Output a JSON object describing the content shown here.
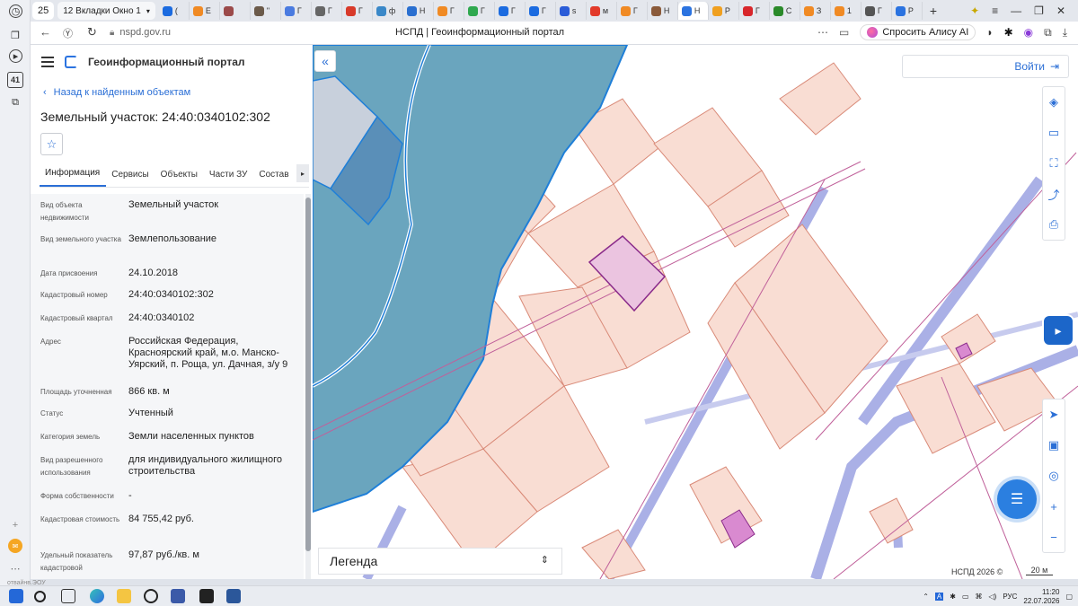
{
  "browser": {
    "tab_count_badge": "25",
    "tab_group_label": "12 Вкладки Окно 1",
    "tabs": [
      {
        "label": "(",
        "color": "#1b6be0"
      },
      {
        "label": "E",
        "color": "#f08a24"
      },
      {
        "label": "",
        "color": "#9b4a4a"
      },
      {
        "label": "\"",
        "color": "#6b5a4a"
      },
      {
        "label": "Г",
        "color": "#4a7be0"
      },
      {
        "label": "Г",
        "color": "#666666"
      },
      {
        "label": "Г",
        "color": "#d83a2a"
      },
      {
        "label": "ф",
        "color": "#3a88c8"
      },
      {
        "label": "Н",
        "color": "#2a6fd0"
      },
      {
        "label": "Г",
        "color": "#f08a24"
      },
      {
        "label": "Г",
        "color": "#2fa84f"
      },
      {
        "label": "Г",
        "color": "#1b6be0"
      },
      {
        "label": "Г",
        "color": "#1b6be0"
      },
      {
        "label": "s",
        "color": "#2a5cd8"
      },
      {
        "label": "м",
        "color": "#e23a2a"
      },
      {
        "label": "Г",
        "color": "#f08a24"
      },
      {
        "label": "Н",
        "color": "#8a5a3a"
      },
      {
        "label": "Н",
        "color": "#2b73e0",
        "active": true
      },
      {
        "label": "Р",
        "color": "#f0a020"
      },
      {
        "label": "Г",
        "color": "#d8262b"
      },
      {
        "label": "С",
        "color": "#2a8a2a"
      },
      {
        "label": "З",
        "color": "#f08a24"
      },
      {
        "label": "1",
        "color": "#f08a24"
      },
      {
        "label": "Г",
        "color": "#555555"
      },
      {
        "label": "Р",
        "color": "#2b73e0"
      }
    ],
    "new_tab": "+",
    "url": "nspd.gov.ru",
    "page_title": "НСПД | Геоинформационный портал",
    "alisa_label": "Спросить Алису AI",
    "rail_badge": "41"
  },
  "panel": {
    "app_title": "Геоинформационный портал",
    "back_label": "Назад к найденным объектам",
    "object_title": "Земельный участок: 24:40:0340102:302",
    "tabs": [
      "Информация",
      "Сервисы",
      "Объекты",
      "Части ЗУ",
      "Состав"
    ],
    "properties": [
      {
        "label": "Вид объекта недвижимости",
        "value": "Земельный участок"
      },
      {
        "label": "Вид земельного участка",
        "value": "Землепользование"
      },
      {
        "label": "Дата присвоения",
        "value": "24.10.2018"
      },
      {
        "label": "Кадастровый номер",
        "value": "24:40:0340102:302"
      },
      {
        "label": "Кадастровый квартал",
        "value": "24:40:0340102"
      },
      {
        "label": "Адрес",
        "value": "Российская Федерация, Красноярский край, м.о. Манско-Уярский, п. Роща, ул. Дачная, з/у 9"
      },
      {
        "label": "Площадь уточненная",
        "value": "866 кв. м"
      },
      {
        "label": "Статус",
        "value": "Учтенный"
      },
      {
        "label": "Категория земель",
        "value": "Земли населенных пунктов"
      },
      {
        "label": "Вид разрешенного использования",
        "value": "для индивидуального жилищного строительства"
      },
      {
        "label": "Форма собственности",
        "value": "-"
      },
      {
        "label": "Кадастровая стоимость",
        "value": "84 755,42 руб."
      },
      {
        "label": "Удельный показатель кадастровой",
        "value": "97,87 руб./кв. м"
      }
    ]
  },
  "map": {
    "login_label": "Войти",
    "legend_label": "Легенда",
    "copyright": "НСПД 2026 ©",
    "scale_label": "20 м",
    "colors": {
      "parcel_fill": "#f9ddd3",
      "parcel_stroke": "#d98a78",
      "water": "#6aa5be",
      "water_edge": "#1f7fd8",
      "selected": "#ebc4e0",
      "road": "#aab0e6"
    }
  },
  "taskbar": {
    "lang": "РУС",
    "time": "11:20",
    "date": "22.07.2026",
    "bottom_text": "отвайнв.ЭОУ"
  }
}
